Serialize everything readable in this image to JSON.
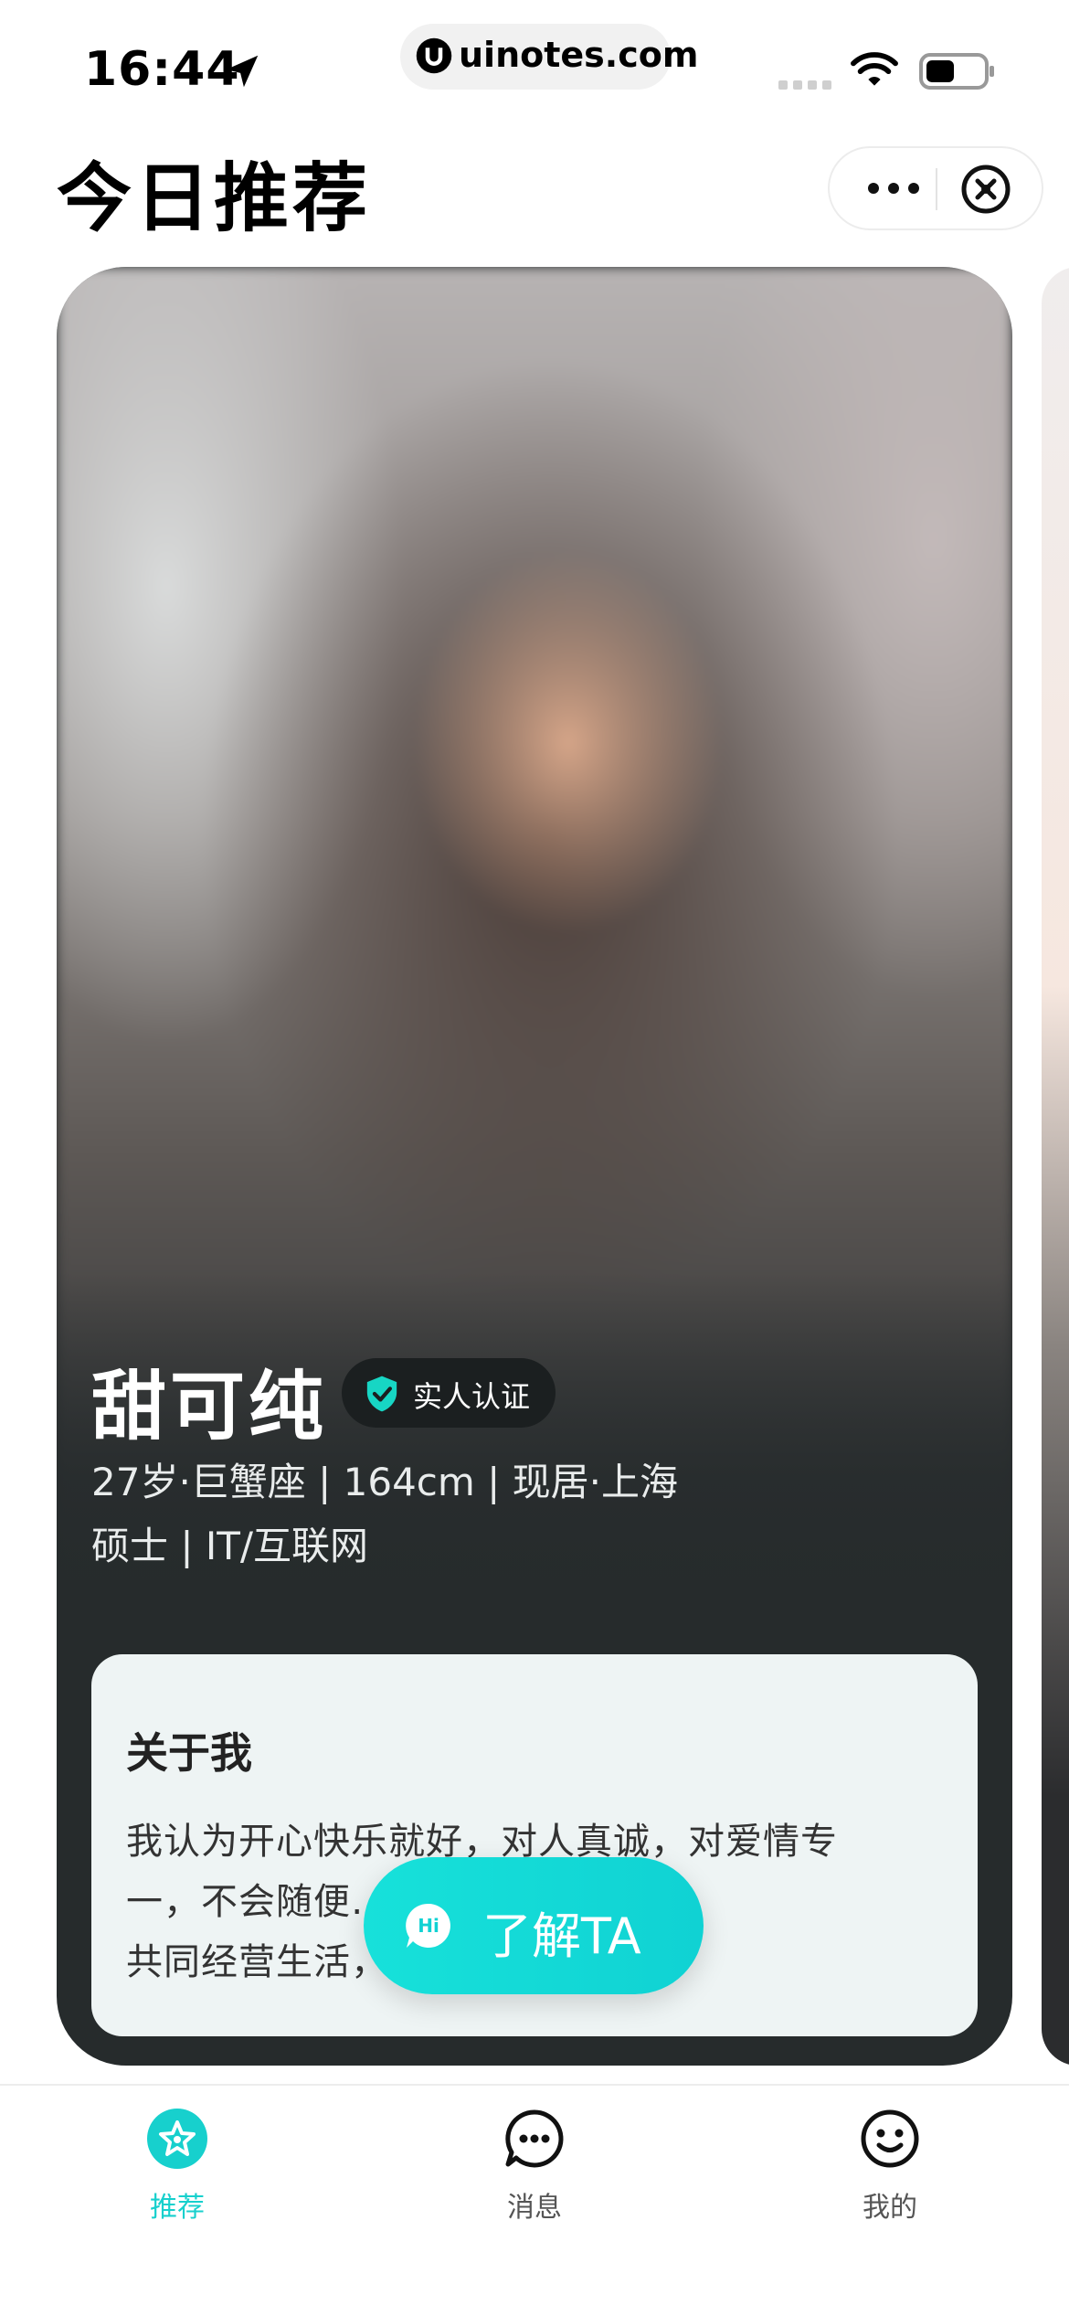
{
  "status_bar": {
    "time": "16:44",
    "url": "uinotes.com"
  },
  "header": {
    "title": "今日推荐"
  },
  "profile": {
    "name": "甜可纯",
    "verified_label": "实人认证",
    "info_line1": "27岁·巨蟹座 | 164cm | 现居·上海",
    "info_line2": "硕士 | IT/互联网",
    "about_title": "关于我",
    "about_text_lines": [
      "我认为开心快乐就好，对人真诚，对爱情专",
      "一，不会随便……… 稳定的工作…",
      "共同经营生活，"
    ]
  },
  "cta": {
    "label": "了解TA"
  },
  "tabbar": {
    "items": [
      {
        "label": "推荐",
        "active": true
      },
      {
        "label": "消息",
        "active": false
      },
      {
        "label": "我的",
        "active": false
      }
    ]
  },
  "colors": {
    "accent": "#17d0cd",
    "card_dark": "#262b2c"
  },
  "icons": [
    "location-arrow-icon",
    "uinotes-logo-icon",
    "signal-icon",
    "wifi-icon",
    "battery-icon",
    "more-dots-icon",
    "close-circle-icon",
    "shield-check-icon",
    "hi-chat-icon",
    "star-icon",
    "message-icon",
    "smiley-icon"
  ]
}
